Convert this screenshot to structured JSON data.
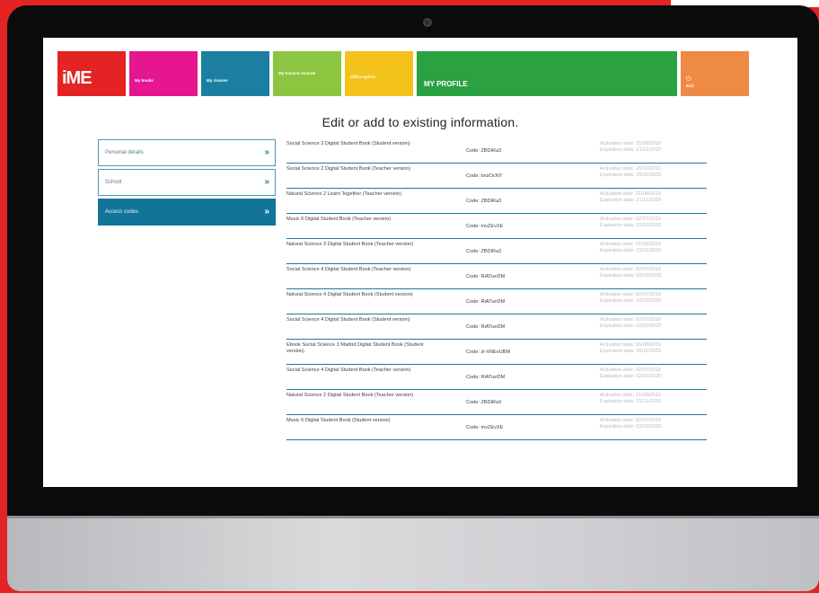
{
  "nav": {
    "logo": "iME",
    "tiles": {
      "books": "My books",
      "classes": "My classes",
      "tracked": "My tracked records",
      "office": "Office option",
      "profile": "MY PROFILE",
      "exit": "Exit"
    }
  },
  "heading": "Edit or add to existing information.",
  "side_menu": [
    {
      "label": "Personal details"
    },
    {
      "label": "School"
    },
    {
      "label": "Access codes"
    }
  ],
  "codes": [
    {
      "title": "Social Science 3 Digital Student Book (Student version)",
      "code": "Code: ZBDiRa3",
      "activation": "Activation date: 21/08/2019",
      "expiration": "Expiration date: 21/11/2020"
    },
    {
      "title": "Social Science 2 Digital Student Book (Teacher version)",
      "code": "Code: bnzOcNY",
      "activation": "Activation date: 26/10/2019",
      "expiration": "Expiration date: 26/10/2020"
    },
    {
      "title": "Natural Science 2 Learn Together (Teacher version)",
      "code": "Code: ZBDiRa3",
      "activation": "Activation date: 21/08/2019",
      "expiration": "Expiration date: 21/11/2020"
    },
    {
      "title": "Music 6 Digital Student Book (Teacher version)",
      "code": "Code: mvZEvXE",
      "activation": "Activation date: 02/07/2019",
      "expiration": "Expiration date: 02/10/2020"
    },
    {
      "title": "Natural Science 3 Digital Student Book (Teacher version)",
      "code": "Code: ZBDiRa3",
      "activation": "Activation date: 21/08/2019",
      "expiration": "Expiration date: 21/11/2020"
    },
    {
      "title": "Social Science 4 Digital Student Book (Teacher version)",
      "code": "Code: RiATueDM",
      "activation": "Activation date: 02/07/2019",
      "expiration": "Expiration date: 02/10/2020"
    },
    {
      "title": "Natural Science 4 Digital Student Book (Student version)",
      "code": "Code: RiATueDM",
      "activation": "Activation date: 02/07/2019",
      "expiration": "Expiration date: 02/10/2020"
    },
    {
      "title": "Social Science 4 Digital Student Book (Student version)",
      "code": "Code: RiATueDM",
      "activation": "Activation date: 02/07/2019",
      "expiration": "Expiration date: 02/10/2020"
    },
    {
      "title": "Ebook Social Science 3 Madrid Digital Student Book (Student version)",
      "code": "Code: zl-XNEvUBM",
      "activation": "Activation date: 26/08/2019",
      "expiration": "Expiration date: 26/11/2020"
    },
    {
      "title": "Social Science 4 Digital Student Book (Teacher version)",
      "code": "Code: RiATueDM",
      "activation": "Activation date: 02/07/2019",
      "expiration": "Expiration date: 02/10/2020"
    },
    {
      "title": "Natural Science 2 Digital Student Book (Teacher version)",
      "code": "Code: ZBDiRa3",
      "activation": "Activation date: 21/08/2019",
      "expiration": "Expiration date: 21/11/2020"
    },
    {
      "title": "Music 6 Digital Student Book (Student version)",
      "code": "Code: mvZEvXE",
      "activation": "Activation date: 02/07/2019",
      "expiration": "Expiration date: 02/10/2020"
    }
  ]
}
